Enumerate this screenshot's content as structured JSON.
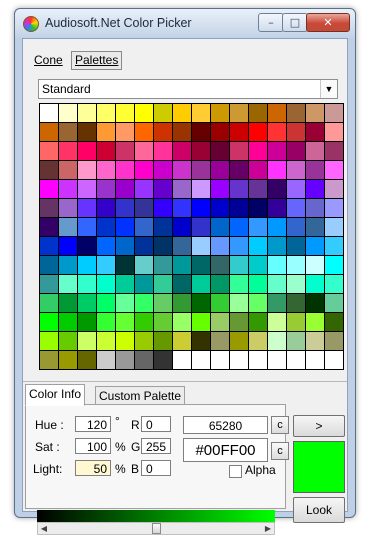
{
  "window": {
    "title": "Audiosoft.Net Color Picker",
    "minimize_glyph": "–",
    "maximize_glyph": "□",
    "close_glyph": "✕"
  },
  "menu": {
    "cone_label": "Cone",
    "palettes_label": "Palettes"
  },
  "palette_select": {
    "value": "Standard",
    "arrow_glyph": "▼"
  },
  "palette_colors": [
    "#ffffff",
    "#ffffcc",
    "#ffff99",
    "#ffff66",
    "#ffff33",
    "#ffff00",
    "#cccc00",
    "#ffcc00",
    "#ffcc33",
    "#cc9900",
    "#cc9933",
    "#996600",
    "#cc6600",
    "#996633",
    "#cc9966",
    "#cc9999",
    "#cc6600",
    "#996633",
    "#663300",
    "#ff9933",
    "#ff9966",
    "#ff6600",
    "#cc3300",
    "#993300",
    "#660000",
    "#990000",
    "#cc0000",
    "#ff0000",
    "#ff3333",
    "#cc3333",
    "#990033",
    "#ff9999",
    "#ff6666",
    "#ff3366",
    "#ff0066",
    "#cc0033",
    "#cc3366",
    "#ff6699",
    "#ff3399",
    "#cc0066",
    "#990033",
    "#660033",
    "#cc3366",
    "#ff0099",
    "#cc0099",
    "#990066",
    "#cc6699",
    "#993366",
    "#663333",
    "#cc6666",
    "#ff99cc",
    "#ff66cc",
    "#ff33cc",
    "#ff00cc",
    "#cc00cc",
    "#cc33cc",
    "#993399",
    "#990099",
    "#660066",
    "#cc0099",
    "#ff33ff",
    "#cc66cc",
    "#993399",
    "#ff66ff",
    "#ff00ff",
    "#cc33ff",
    "#cc66ff",
    "#9933cc",
    "#9900cc",
    "#9933ff",
    "#6600cc",
    "#9966cc",
    "#cc99ff",
    "#9900ff",
    "#6633cc",
    "#663399",
    "#330066",
    "#9966ff",
    "#6600ff",
    "#cc99cc",
    "#663366",
    "#9966cc",
    "#6633ff",
    "#3300cc",
    "#3333cc",
    "#333399",
    "#3300ff",
    "#3333ff",
    "#0000ff",
    "#0000cc",
    "#000099",
    "#000066",
    "#330099",
    "#6666ff",
    "#6666cc",
    "#9999ff",
    "#330066",
    "#6699cc",
    "#3366ff",
    "#0033cc",
    "#0033ff",
    "#3366cc",
    "#003399",
    "#0000cc",
    "#3333cc",
    "#0066cc",
    "#0066ff",
    "#3399ff",
    "#0099ff",
    "#3366cc",
    "#336699",
    "#99ccff",
    "#0033cc",
    "#0000ff",
    "#000066",
    "#0066ff",
    "#0066cc",
    "#003399",
    "#003366",
    "#336699",
    "#99ccff",
    "#6699ff",
    "#3399ff",
    "#00ccff",
    "#0099cc",
    "#006699",
    "#0099ff",
    "#33ccff",
    "#006699",
    "#0099cc",
    "#00ccff",
    "#33ccff",
    "#003333",
    "#66cccc",
    "#339999",
    "#009999",
    "#006666",
    "#336666",
    "#33cccc",
    "#00cccc",
    "#66ffff",
    "#99ffff",
    "#ccffff",
    "#00ffff",
    "#339999",
    "#66ffcc",
    "#33ffcc",
    "#00ffcc",
    "#00cc99",
    "#009999",
    "#33cc99",
    "#006666",
    "#00cc99",
    "#009966",
    "#33ff99",
    "#00ff99",
    "#66ffcc",
    "#99ffcc",
    "#00ffcc",
    "#33ffcc",
    "#33cc66",
    "#009933",
    "#00cc66",
    "#00ff66",
    "#66ff99",
    "#33ff66",
    "#66cc66",
    "#339933",
    "#006600",
    "#33cc33",
    "#99ff99",
    "#66ff66",
    "#339966",
    "#336633",
    "#003300",
    "#66cc99",
    "#00ff00",
    "#00cc00",
    "#009900",
    "#33ff33",
    "#66ff33",
    "#33cc00",
    "#66cc33",
    "#99ff66",
    "#66ff00",
    "#99cc66",
    "#669933",
    "#339900",
    "#ccff99",
    "#99cc33",
    "#99ff33",
    "#336600",
    "#99ff00",
    "#66cc00",
    "#ccff66",
    "#ccff33",
    "#ccff00",
    "#99cc00",
    "#669900",
    "#cccc33",
    "#333300",
    "#999966",
    "#999900",
    "#cccc66",
    "#ccffcc",
    "#99cc99",
    "#cccc99",
    "#999966",
    "#999933",
    "#999900",
    "#666600",
    "#cccccc",
    "#999999",
    "#666666",
    "#333333",
    "#ffffff",
    "#ffffff",
    "#ffffff",
    "#ffffff",
    "#ffffff",
    "#ffffff",
    "#ffffff",
    "#ffffff",
    "#ffffff"
  ],
  "tabs": {
    "color_info_label": "Color Info",
    "custom_palette_label": "Custom Palette"
  },
  "color_info": {
    "hue_label": "Hue :",
    "hue_value": "120",
    "hue_unit": "°",
    "sat_label": "Sat :",
    "sat_value": "100",
    "sat_unit": "%",
    "light_label": "Light:",
    "light_value": "50",
    "light_unit": "%",
    "r_label": "R",
    "r_value": "0",
    "g_label": "G",
    "g_value": "255",
    "b_label": "B",
    "b_value": "0",
    "decimal_value": "65280",
    "hex_value": "#00FF00",
    "copy_button_label": "c",
    "alpha_label": "Alpha"
  },
  "actions": {
    "next_label": ">",
    "look_label": "Look"
  },
  "scrollbar": {
    "left_glyph": "◀",
    "right_glyph": "▶",
    "position_fraction": 0.5
  },
  "colors": {
    "current_color": "#00FF00",
    "gradient_start": "#000000",
    "gradient_end": "#00FF00"
  }
}
